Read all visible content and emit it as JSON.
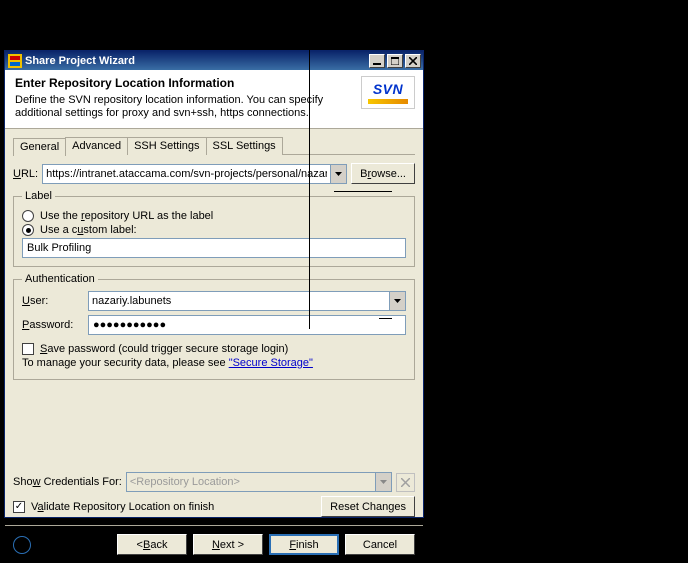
{
  "window": {
    "title": "Share Project Wizard"
  },
  "header": {
    "title": "Enter Repository Location Information",
    "desc": "Define the SVN repository location information. You can specify additional settings for proxy and svn+ssh, https connections.",
    "badge_text": "SVN"
  },
  "tabs": {
    "general": "General",
    "advanced": "Advanced",
    "ssh": "SSH Settings",
    "ssl": "SSL Settings"
  },
  "url": {
    "label_pre": "",
    "label_u": "U",
    "label_post": "RL:",
    "value": "https://intranet.ataccama.com/svn-projects/personal/nazariy.la",
    "browse_pre": "B",
    "browse_u": "r",
    "browse_post": "owse..."
  },
  "label_group": {
    "legend": "Label",
    "use_url_pre": "Use the ",
    "use_url_u": "r",
    "use_url_post": "epository URL as the label",
    "use_custom_pre": "Use a c",
    "use_custom_u": "u",
    "use_custom_post": "stom label:",
    "custom_value": "Bulk Profiling"
  },
  "auth": {
    "legend": "Authentication",
    "user_u": "U",
    "user_post": "ser:",
    "user_value": "nazariy.labunets",
    "pass_u": "P",
    "pass_post": "assword:",
    "pass_value": "●●●●●●●●●●●",
    "save_u": "S",
    "save_post": "ave password (could trigger secure storage login)",
    "hint_pre": "To manage your security data, please see ",
    "hint_link": "\"Secure Storage\""
  },
  "cred": {
    "label_pre": "Sho",
    "label_u": "w",
    "label_post": " Credentials For:",
    "placeholder": "<Repository Location>"
  },
  "validate": {
    "pre": "V",
    "u": "a",
    "post": "lidate Repository Location on finish"
  },
  "reset": "Reset Changes",
  "buttons": {
    "back_pre": "< ",
    "back_u": "B",
    "back_post": "ack",
    "next_u": "N",
    "next_post": "ext >",
    "finish_u": "F",
    "finish_post": "inish",
    "cancel": "Cancel"
  },
  "help": "?"
}
